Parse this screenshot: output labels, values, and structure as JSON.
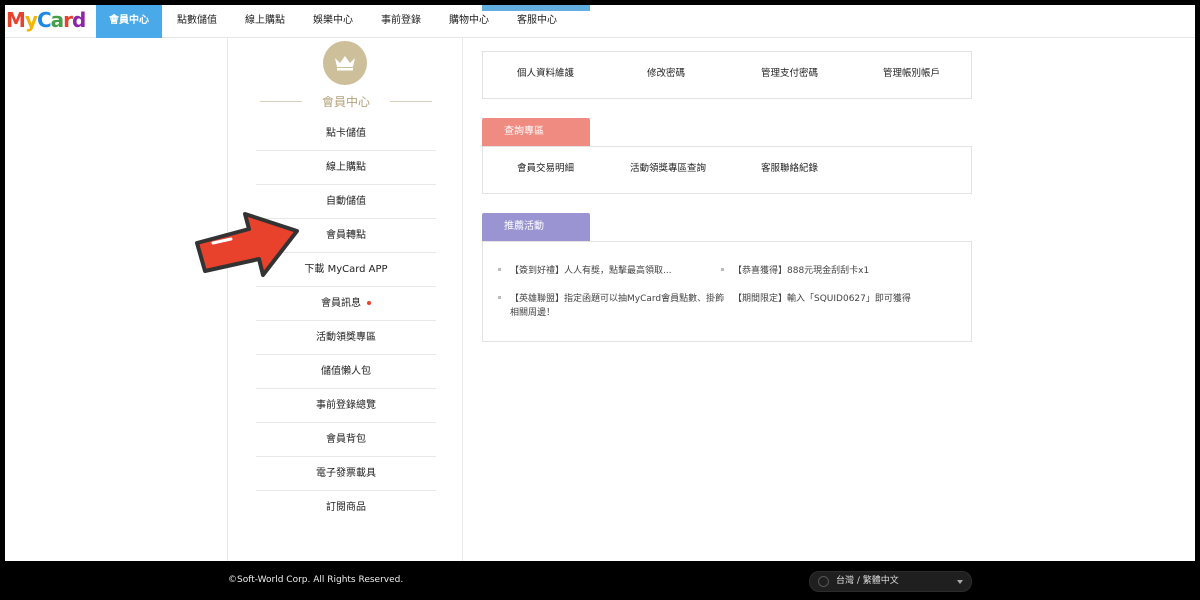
{
  "brand": {
    "logo_text": "MyCard"
  },
  "nav": {
    "items": [
      {
        "label": "會員中心",
        "active": true
      },
      {
        "label": "點數儲值"
      },
      {
        "label": "線上購點"
      },
      {
        "label": "娛樂中心"
      },
      {
        "label": "事前登錄"
      },
      {
        "label": "購物中心"
      },
      {
        "label": "客服中心"
      }
    ]
  },
  "sidebar": {
    "title": "會員中心",
    "icon": "crown-icon",
    "items": [
      {
        "label": "點卡儲值"
      },
      {
        "label": "線上購點"
      },
      {
        "label": "自動儲值"
      },
      {
        "label": "會員轉點"
      },
      {
        "label": "下載 MyCard APP"
      },
      {
        "label": "會員訊息",
        "has_dot": true
      },
      {
        "label": "活動領獎專區"
      },
      {
        "label": "儲值懶人包"
      },
      {
        "label": "事前登錄總覽"
      },
      {
        "label": "會員背包"
      },
      {
        "label": "電子發票載具"
      },
      {
        "label": "訂閱商品"
      }
    ]
  },
  "account_panel": {
    "links": [
      "個人資料維護",
      "修改密碼",
      "管理支付密碼",
      "管理帳別帳戶"
    ]
  },
  "query_panel": {
    "tab": "查詢專區",
    "links": [
      "會員交易明細",
      "活動領獎專區查詢",
      "客服聯絡紀錄"
    ]
  },
  "promo_panel": {
    "tab": "推薦活動",
    "events": [
      "【簽到好禮】人人有獎，點擊最高領取...",
      "【恭喜獲得】888元現金刮刮卡x1",
      "【英雄聯盟】指定函題可以抽MyCard會員點數、掛飾",
      "相關周邊！",
      "【期間限定】輸入「SQUID0627」即可獲得"
    ]
  },
  "footer": {
    "copyright": "©Soft-World Corp. All Rights Reserved.",
    "language": "台灣 / 繁體中文"
  },
  "colors": {
    "nav_active": "#4aa9e8",
    "tab_blue": "#62aee0",
    "tab_red": "#ef8b81",
    "tab_purple": "#9a94d3",
    "arrow": "#e8412c",
    "crown_bg": "#cdbf9a"
  }
}
